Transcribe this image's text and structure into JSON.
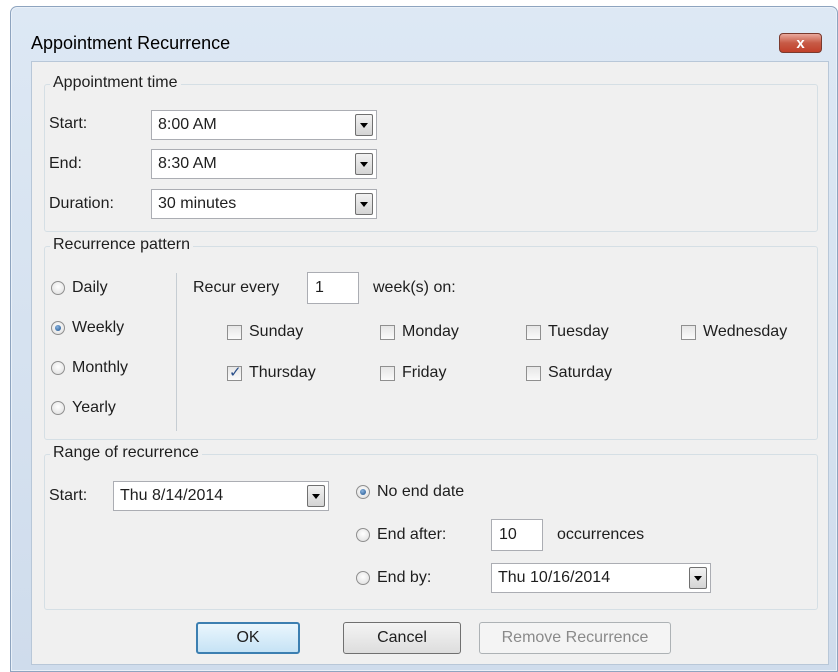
{
  "window": {
    "title": "Appointment Recurrence",
    "close_symbol": "x"
  },
  "appointment_time": {
    "legend": "Appointment time",
    "start_label": "Start:",
    "start_value": "8:00 AM",
    "end_label": "End:",
    "end_value": "8:30 AM",
    "duration_label": "Duration:",
    "duration_value": "30 minutes"
  },
  "pattern": {
    "legend": "Recurrence pattern",
    "types": [
      {
        "label": "Daily",
        "selected": false
      },
      {
        "label": "Weekly",
        "selected": true
      },
      {
        "label": "Monthly",
        "selected": false
      },
      {
        "label": "Yearly",
        "selected": false
      }
    ],
    "recur_every_label": "Recur every",
    "recur_every_value": "1",
    "weeks_on_label": "week(s) on:",
    "days": [
      {
        "label": "Sunday",
        "checked": false
      },
      {
        "label": "Monday",
        "checked": false
      },
      {
        "label": "Tuesday",
        "checked": false
      },
      {
        "label": "Wednesday",
        "checked": false
      },
      {
        "label": "Thursday",
        "checked": true
      },
      {
        "label": "Friday",
        "checked": false
      },
      {
        "label": "Saturday",
        "checked": false
      }
    ]
  },
  "range": {
    "legend": "Range of recurrence",
    "start_label": "Start:",
    "start_value": "Thu 8/14/2014",
    "no_end_label": "No end date",
    "end_after_label": "End after:",
    "end_after_value": "10",
    "occurrences_label": "occurrences",
    "end_by_label": "End by:",
    "end_by_value": "Thu 10/16/2014",
    "selected": "no_end"
  },
  "buttons": {
    "ok": "OK",
    "cancel": "Cancel",
    "remove": "Remove Recurrence"
  }
}
